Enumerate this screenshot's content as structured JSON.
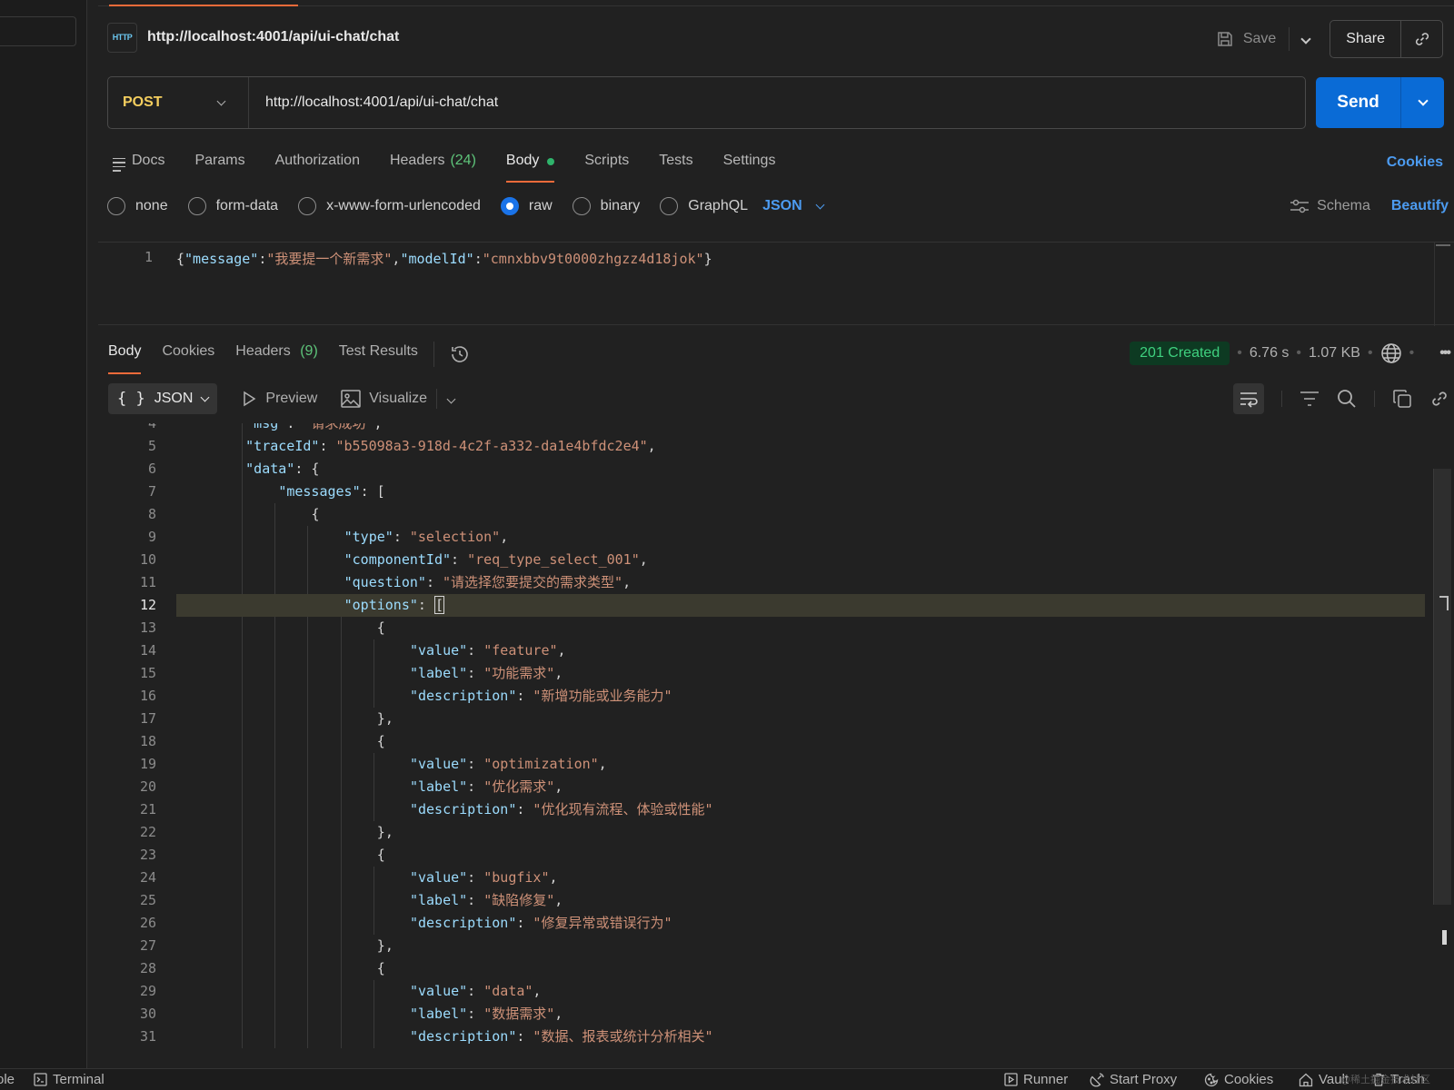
{
  "request": {
    "title": "http://localhost:4001/api/ui-chat/chat",
    "method": "POST",
    "url": "http://localhost:4001/api/ui-chat/chat",
    "save_label": "Save",
    "share_label": "Share",
    "send_label": "Send"
  },
  "req_tabs": {
    "docs": "Docs",
    "params": "Params",
    "authorization": "Authorization",
    "headers": "Headers",
    "headers_count": "(24)",
    "body": "Body",
    "scripts": "Scripts",
    "tests": "Tests",
    "settings": "Settings",
    "cookies": "Cookies"
  },
  "body_types": {
    "none": "none",
    "form_data": "form-data",
    "urlencoded": "x-www-form-urlencoded",
    "raw": "raw",
    "binary": "binary",
    "graphql": "GraphQL",
    "format": "JSON",
    "selected": "raw",
    "schema": "Schema",
    "beautify": "Beautify"
  },
  "req_body": {
    "line_number": "1",
    "k_message": "\"message\"",
    "v_message": "\"我要提一个新需求\"",
    "k_model": "\"modelId\"",
    "v_model": "\"cmnxbbv9t0000zhgzz4d18jok\""
  },
  "response": {
    "tabs": {
      "body": "Body",
      "cookies": "Cookies",
      "headers": "Headers",
      "headers_count": "(9)",
      "test_results": "Test Results"
    },
    "status": "201 Created",
    "time": "6.76 s",
    "size": "1.07 KB",
    "format": "JSON",
    "preview": "Preview",
    "visualize": "Visualize"
  },
  "code": {
    "highlight_line": 12,
    "lines": [
      {
        "n": "4",
        "indent": 1,
        "tokens": [
          {
            "t": "k",
            "v": "\"msg\""
          },
          {
            "t": "p",
            "v": ": "
          },
          {
            "t": "s",
            "v": "\"请求成功\""
          },
          {
            "t": "p",
            "v": ","
          }
        ]
      },
      {
        "n": "5",
        "indent": 1,
        "tokens": [
          {
            "t": "k",
            "v": "\"traceId\""
          },
          {
            "t": "p",
            "v": ": "
          },
          {
            "t": "s",
            "v": "\"b55098a3-918d-4c2f-a332-da1e4bfdc2e4\""
          },
          {
            "t": "p",
            "v": ","
          }
        ]
      },
      {
        "n": "6",
        "indent": 1,
        "tokens": [
          {
            "t": "k",
            "v": "\"data\""
          },
          {
            "t": "p",
            "v": ": {"
          }
        ]
      },
      {
        "n": "7",
        "indent": 2,
        "tokens": [
          {
            "t": "k",
            "v": "\"messages\""
          },
          {
            "t": "p",
            "v": ": ["
          }
        ]
      },
      {
        "n": "8",
        "indent": 3,
        "tokens": [
          {
            "t": "p",
            "v": "{"
          }
        ]
      },
      {
        "n": "9",
        "indent": 4,
        "tokens": [
          {
            "t": "k",
            "v": "\"type\""
          },
          {
            "t": "p",
            "v": ": "
          },
          {
            "t": "s",
            "v": "\"selection\""
          },
          {
            "t": "p",
            "v": ","
          }
        ]
      },
      {
        "n": "10",
        "indent": 4,
        "tokens": [
          {
            "t": "k",
            "v": "\"componentId\""
          },
          {
            "t": "p",
            "v": ": "
          },
          {
            "t": "s",
            "v": "\"req_type_select_001\""
          },
          {
            "t": "p",
            "v": ","
          }
        ]
      },
      {
        "n": "11",
        "indent": 4,
        "tokens": [
          {
            "t": "k",
            "v": "\"question\""
          },
          {
            "t": "p",
            "v": ": "
          },
          {
            "t": "s",
            "v": "\"请选择您要提交的需求类型\""
          },
          {
            "t": "p",
            "v": ","
          }
        ]
      },
      {
        "n": "12",
        "indent": 4,
        "tokens": [
          {
            "t": "k",
            "v": "\"options\""
          },
          {
            "t": "p",
            "v": ": "
          },
          {
            "t": "c",
            "v": "["
          }
        ]
      },
      {
        "n": "13",
        "indent": 5,
        "tokens": [
          {
            "t": "p",
            "v": "{"
          }
        ]
      },
      {
        "n": "14",
        "indent": 6,
        "tokens": [
          {
            "t": "k",
            "v": "\"value\""
          },
          {
            "t": "p",
            "v": ": "
          },
          {
            "t": "s",
            "v": "\"feature\""
          },
          {
            "t": "p",
            "v": ","
          }
        ]
      },
      {
        "n": "15",
        "indent": 6,
        "tokens": [
          {
            "t": "k",
            "v": "\"label\""
          },
          {
            "t": "p",
            "v": ": "
          },
          {
            "t": "s",
            "v": "\"功能需求\""
          },
          {
            "t": "p",
            "v": ","
          }
        ]
      },
      {
        "n": "16",
        "indent": 6,
        "tokens": [
          {
            "t": "k",
            "v": "\"description\""
          },
          {
            "t": "p",
            "v": ": "
          },
          {
            "t": "s",
            "v": "\"新增功能或业务能力\""
          }
        ]
      },
      {
        "n": "17",
        "indent": 5,
        "tokens": [
          {
            "t": "p",
            "v": "},"
          }
        ]
      },
      {
        "n": "18",
        "indent": 5,
        "tokens": [
          {
            "t": "p",
            "v": "{"
          }
        ]
      },
      {
        "n": "19",
        "indent": 6,
        "tokens": [
          {
            "t": "k",
            "v": "\"value\""
          },
          {
            "t": "p",
            "v": ": "
          },
          {
            "t": "s",
            "v": "\"optimization\""
          },
          {
            "t": "p",
            "v": ","
          }
        ]
      },
      {
        "n": "20",
        "indent": 6,
        "tokens": [
          {
            "t": "k",
            "v": "\"label\""
          },
          {
            "t": "p",
            "v": ": "
          },
          {
            "t": "s",
            "v": "\"优化需求\""
          },
          {
            "t": "p",
            "v": ","
          }
        ]
      },
      {
        "n": "21",
        "indent": 6,
        "tokens": [
          {
            "t": "k",
            "v": "\"description\""
          },
          {
            "t": "p",
            "v": ": "
          },
          {
            "t": "s",
            "v": "\"优化现有流程、体验或性能\""
          }
        ]
      },
      {
        "n": "22",
        "indent": 5,
        "tokens": [
          {
            "t": "p",
            "v": "},"
          }
        ]
      },
      {
        "n": "23",
        "indent": 5,
        "tokens": [
          {
            "t": "p",
            "v": "{"
          }
        ]
      },
      {
        "n": "24",
        "indent": 6,
        "tokens": [
          {
            "t": "k",
            "v": "\"value\""
          },
          {
            "t": "p",
            "v": ": "
          },
          {
            "t": "s",
            "v": "\"bugfix\""
          },
          {
            "t": "p",
            "v": ","
          }
        ]
      },
      {
        "n": "25",
        "indent": 6,
        "tokens": [
          {
            "t": "k",
            "v": "\"label\""
          },
          {
            "t": "p",
            "v": ": "
          },
          {
            "t": "s",
            "v": "\"缺陷修复\""
          },
          {
            "t": "p",
            "v": ","
          }
        ]
      },
      {
        "n": "26",
        "indent": 6,
        "tokens": [
          {
            "t": "k",
            "v": "\"description\""
          },
          {
            "t": "p",
            "v": ": "
          },
          {
            "t": "s",
            "v": "\"修复异常或错误行为\""
          }
        ]
      },
      {
        "n": "27",
        "indent": 5,
        "tokens": [
          {
            "t": "p",
            "v": "},"
          }
        ]
      },
      {
        "n": "28",
        "indent": 5,
        "tokens": [
          {
            "t": "p",
            "v": "{"
          }
        ]
      },
      {
        "n": "29",
        "indent": 6,
        "tokens": [
          {
            "t": "k",
            "v": "\"value\""
          },
          {
            "t": "p",
            "v": ": "
          },
          {
            "t": "s",
            "v": "\"data\""
          },
          {
            "t": "p",
            "v": ","
          }
        ]
      },
      {
        "n": "30",
        "indent": 6,
        "tokens": [
          {
            "t": "k",
            "v": "\"label\""
          },
          {
            "t": "p",
            "v": ": "
          },
          {
            "t": "s",
            "v": "\"数据需求\""
          },
          {
            "t": "p",
            "v": ","
          }
        ]
      },
      {
        "n": "31",
        "indent": 6,
        "tokens": [
          {
            "t": "k",
            "v": "\"description\""
          },
          {
            "t": "p",
            "v": ": "
          },
          {
            "t": "s",
            "v": "\"数据、报表或统计分析相关\""
          }
        ]
      }
    ]
  },
  "footer": {
    "console_partial": "ole",
    "terminal": "Terminal",
    "runner": "Runner",
    "start_proxy": "Start Proxy",
    "cookies": "Cookies",
    "vault": "Vault",
    "trash": "Trash",
    "watermark": "@稀土掘金技术社区"
  },
  "colors": {
    "accent": "#f26b3a",
    "send": "#0a6bd6",
    "link": "#4c9bf0",
    "method": "#f4ce5e",
    "status_bg": "#0d3a22",
    "status_text": "#3fd17f",
    "json_key": "#9cdcfe",
    "json_string": "#ce9178"
  }
}
